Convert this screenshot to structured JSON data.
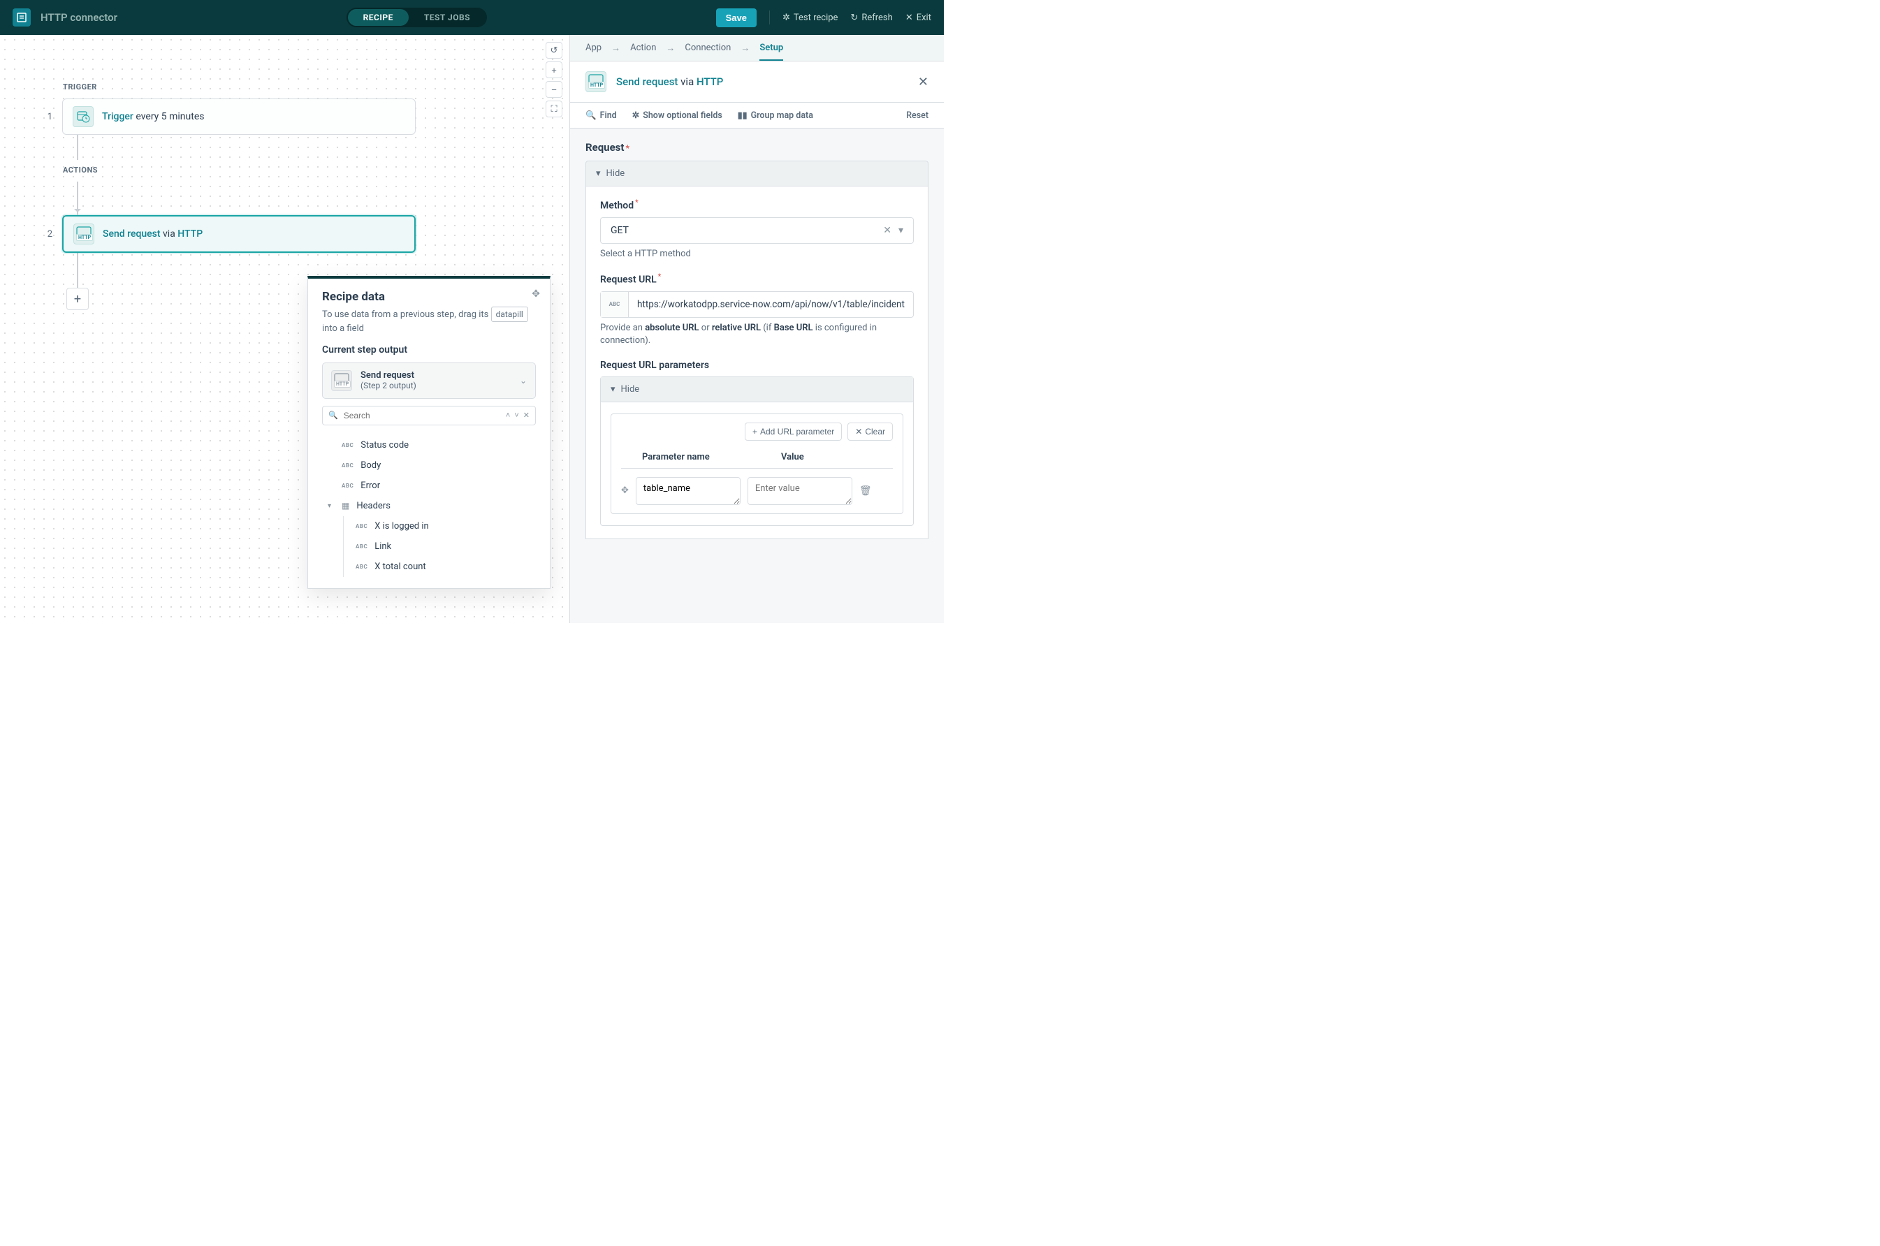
{
  "topbar": {
    "title": "HTTP connector",
    "tabs": {
      "recipe": "RECIPE",
      "test_jobs": "TEST JOBS"
    },
    "save": "Save",
    "test_recipe": "Test recipe",
    "refresh": "Refresh",
    "exit": "Exit"
  },
  "canvas": {
    "trigger_label": "TRIGGER",
    "actions_label": "ACTIONS",
    "step1": {
      "num": "1",
      "link": "Trigger",
      "rest": " every 5 minutes"
    },
    "step2": {
      "num": "2",
      "link1": "Send request",
      "mid": " via ",
      "link2": "HTTP"
    }
  },
  "popover": {
    "title": "Recipe data",
    "desc_pre": "To use data from a previous step, drag its ",
    "datapill": "datapill",
    "desc_post": " into a field",
    "current_label": "Current step output",
    "output_title": "Send request",
    "output_sub": "(Step 2 output)",
    "search_placeholder": "Search",
    "pills": {
      "status": "Status code",
      "body": "Body",
      "error": "Error",
      "headers": "Headers",
      "logged_in": "X is logged in",
      "link": "Link",
      "total_count": "X total count"
    }
  },
  "panel": {
    "crumbs": {
      "app": "App",
      "action": "Action",
      "connection": "Connection",
      "setup": "Setup"
    },
    "title": {
      "link1": "Send request",
      "mid": " via ",
      "link2": "HTTP"
    },
    "tools": {
      "find": "Find",
      "optional": "Show optional fields",
      "group": "Group map data",
      "reset": "Reset"
    },
    "request_label": "Request",
    "hide": "Hide",
    "method": {
      "label": "Method",
      "value": "GET",
      "hint": "Select a HTTP method"
    },
    "url": {
      "label": "Request URL",
      "value": "https://workatodpp.service-now.com/api/now/v1/table/incident",
      "hint_pre": "Provide an ",
      "hint_b1": "absolute URL",
      "hint_mid": " or ",
      "hint_b2": "relative URL",
      "hint_mid2": " (if ",
      "hint_b3": "Base URL",
      "hint_post": " is configured in connection)."
    },
    "params": {
      "label": "Request URL parameters",
      "add": "Add URL parameter",
      "clear": "Clear",
      "col1": "Parameter name",
      "col2": "Value",
      "row1_name": "table_name",
      "row1_value_ph": "Enter value"
    }
  }
}
